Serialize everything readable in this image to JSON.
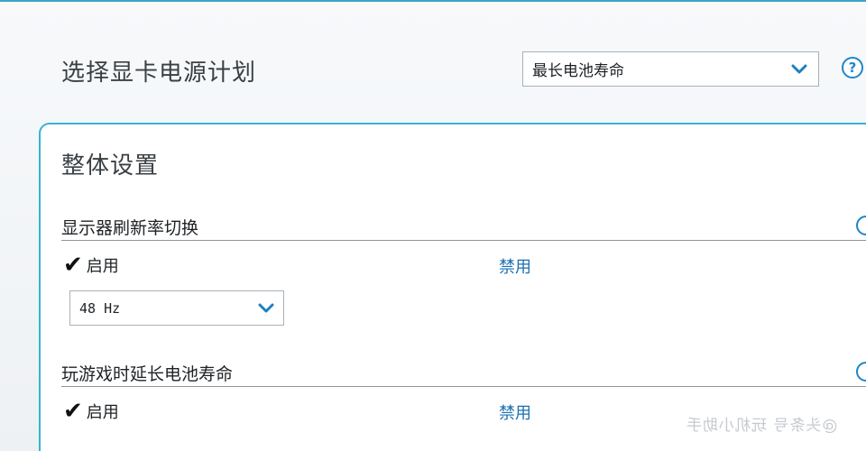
{
  "header": {
    "title": "选择显卡电源计划",
    "plan_select": {
      "value": "最长电池寿命"
    },
    "help_icon": "?"
  },
  "overall": {
    "title": "整体设置",
    "settings": [
      {
        "label": "显示器刷新率切换",
        "enabled_label": "启用",
        "enabled_checked": true,
        "disabled_label": "禁用",
        "refresh_select": {
          "value": "48 Hz"
        }
      },
      {
        "label": "玩游戏时延长电池寿命",
        "enabled_label": "启用",
        "enabled_checked": true,
        "disabled_label": "禁用"
      }
    ]
  },
  "icons": {
    "check": "✔",
    "chevron": "chevron-down-icon",
    "help": "question-circle-icon"
  },
  "colors": {
    "accent": "#36b4cf",
    "link": "#1b6fb0",
    "chevron": "#1e7fc0"
  },
  "watermark": "@头条号 玩机小助手"
}
